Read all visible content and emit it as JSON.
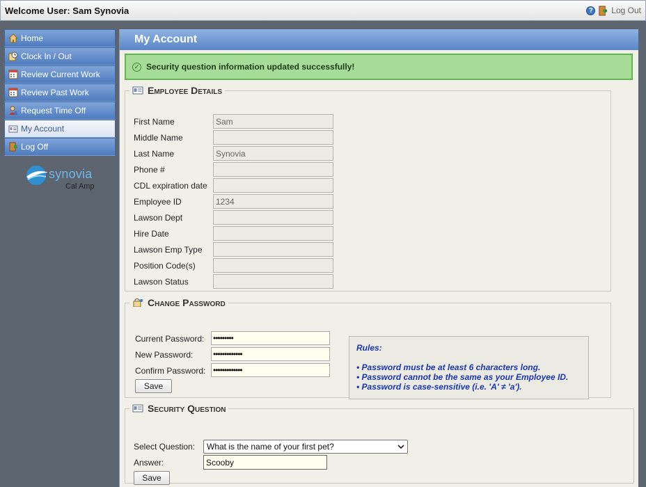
{
  "topbar": {
    "welcome": "Welcome User: Sam Synovia",
    "logout_label": "Log Out"
  },
  "sidebar": {
    "items": [
      {
        "label": "Home",
        "icon": "home-icon"
      },
      {
        "label": "Clock In / Out",
        "icon": "clock-icon"
      },
      {
        "label": "Review Current Work",
        "icon": "calendar-icon"
      },
      {
        "label": "Review Past Work",
        "icon": "calendar-icon"
      },
      {
        "label": "Request Time Off",
        "icon": "person-icon"
      },
      {
        "label": "My Account",
        "icon": "id-card-icon",
        "active": true
      },
      {
        "label": "Log Off",
        "icon": "door-icon"
      }
    ],
    "logo": {
      "brand": "synovia",
      "sub": "Cal Amp"
    }
  },
  "main": {
    "title": "My Account",
    "success_message": "Security question information updated successfully!"
  },
  "employee_details": {
    "legend": "Employee Details",
    "fields": [
      {
        "label": "First Name",
        "value": "Sam"
      },
      {
        "label": "Middle Name",
        "value": ""
      },
      {
        "label": "Last Name",
        "value": "Synovia"
      },
      {
        "label": "Phone #",
        "value": ""
      },
      {
        "label": "CDL expiration date",
        "value": ""
      },
      {
        "label": "Employee ID",
        "value": "1234"
      },
      {
        "label": "Lawson Dept",
        "value": ""
      },
      {
        "label": "Hire Date",
        "value": ""
      },
      {
        "label": "Lawson Emp Type",
        "value": ""
      },
      {
        "label": "Position Code(s)",
        "value": ""
      },
      {
        "label": "Lawson Status",
        "value": ""
      }
    ]
  },
  "change_password": {
    "legend": "Change Password",
    "current_label": "Current Password:",
    "current_value": "•••••••••",
    "new_label": "New Password:",
    "new_value": "•••••••••••••",
    "confirm_label": "Confirm Password:",
    "confirm_value": "•••••••••••••",
    "save_label": "Save",
    "rules_title": "Rules:",
    "rules": [
      "• Password must be at least 6 characters long.",
      "• Password cannot be the same as your Employee ID.",
      "• Password is case-sensitive (i.e. 'A' ≠ 'a')."
    ]
  },
  "security_question": {
    "legend": "Security Question",
    "select_label": "Select Question:",
    "selected_question": "What is the name of your first pet?",
    "answer_label": "Answer:",
    "answer_value": "Scooby",
    "save_label": "Save"
  },
  "colors": {
    "nav_blue": "#5a86c8",
    "success_bg": "#a7dc98",
    "rules_text": "#1a35b3"
  }
}
